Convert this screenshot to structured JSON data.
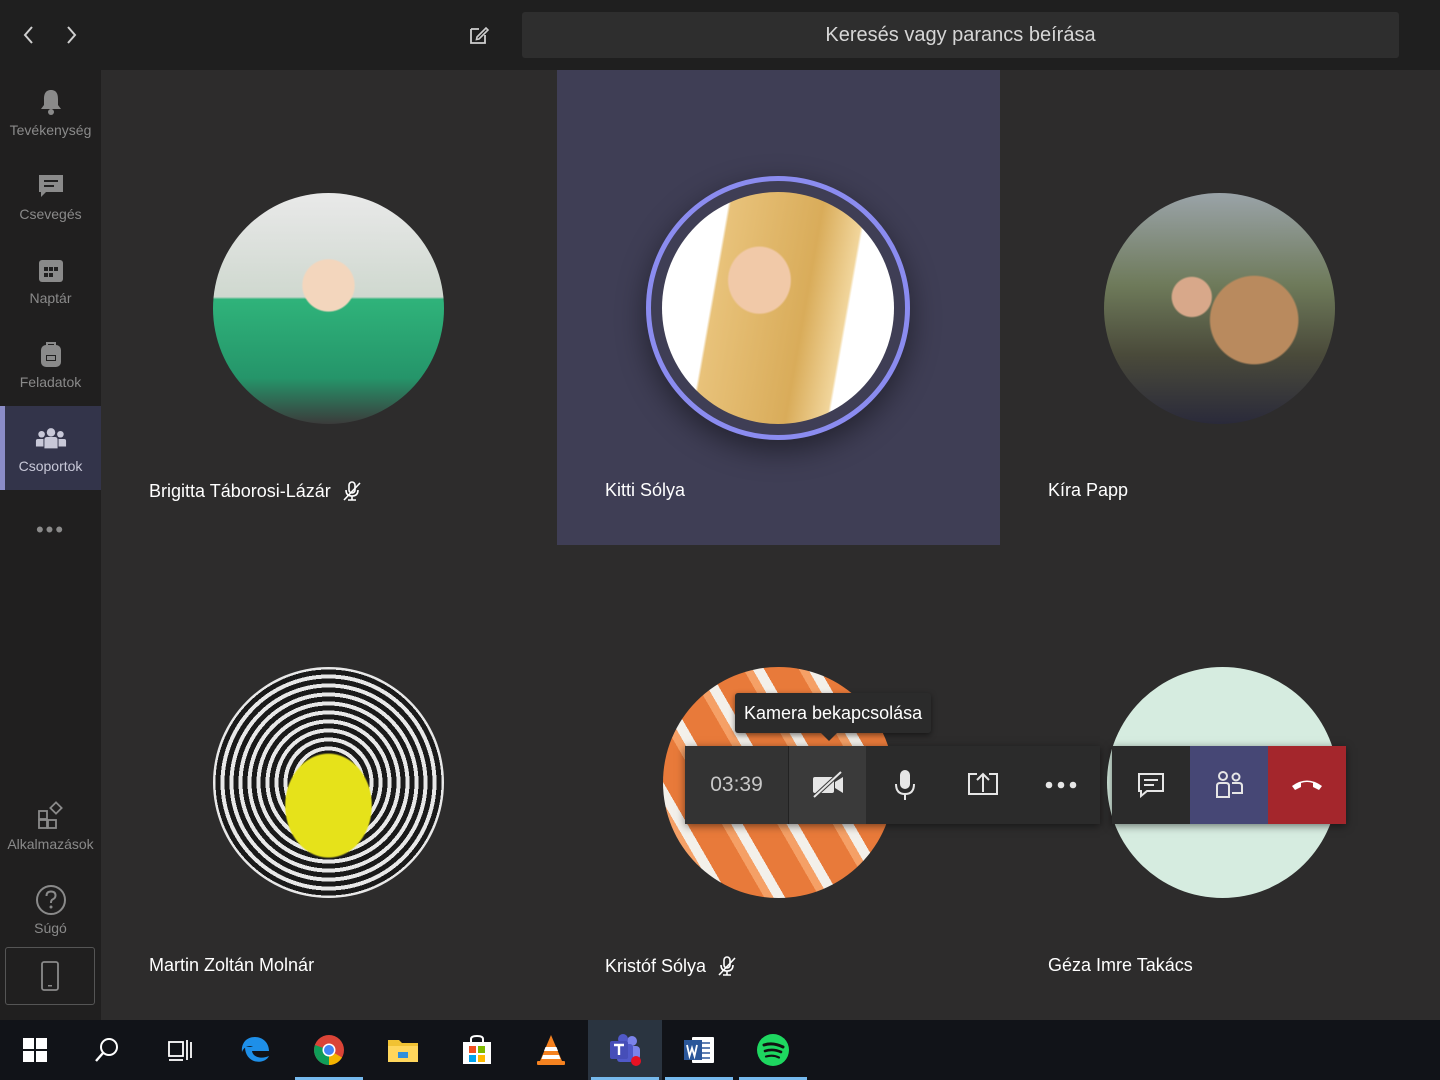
{
  "topbar": {
    "search_placeholder": "Keresés vagy parancs beírása",
    "icons": [
      "chevron-left-icon",
      "chevron-right-icon",
      "compose-icon"
    ]
  },
  "rail": {
    "items": [
      {
        "label": "Tevékenység",
        "icon": "bell-icon"
      },
      {
        "label": "Csevegés",
        "icon": "chat-icon"
      },
      {
        "label": "Naptár",
        "icon": "calendar-icon"
      },
      {
        "label": "Feladatok",
        "icon": "backpack-icon"
      },
      {
        "label": "Csoportok",
        "icon": "teams-icon",
        "active": true
      }
    ],
    "more": "•••",
    "bottom": [
      {
        "label": "Alkalmazások",
        "icon": "apps-icon"
      },
      {
        "label": "Súgó",
        "icon": "help-icon"
      }
    ]
  },
  "participants": [
    {
      "name": "Brigitta Táborosi-Lázár",
      "muted": true,
      "avatar_color": "#2e8b57"
    },
    {
      "name": "Kitti Sólya",
      "muted": false,
      "speaking": true,
      "avatar_color": "#e8c27a"
    },
    {
      "name": "Kíra Papp",
      "muted": false,
      "avatar_color": "#8a6a4a"
    },
    {
      "name": "Martin Zoltán Molnár",
      "muted": false,
      "avatar_color": "#e6e21a"
    },
    {
      "name": "Kristóf Sólya",
      "muted": true,
      "avatar_color": "#e87a3a"
    },
    {
      "name": "Géza Imre Takács",
      "muted": false,
      "avatar_color": "#d6ece0"
    }
  ],
  "call": {
    "timer": "03:39",
    "tooltip": "Kamera bekapcsolása",
    "colors": {
      "accent": "#8b8cc7",
      "hangup": "#a4262c",
      "participants_bg": "#464775"
    }
  },
  "taskbar": {
    "items": [
      "windows-start-icon",
      "search-icon",
      "task-view-icon",
      "edge-icon",
      "chrome-icon",
      "file-explorer-icon",
      "store-icon",
      "vlc-icon",
      "teams-icon",
      "word-icon",
      "spotify-icon"
    ]
  }
}
